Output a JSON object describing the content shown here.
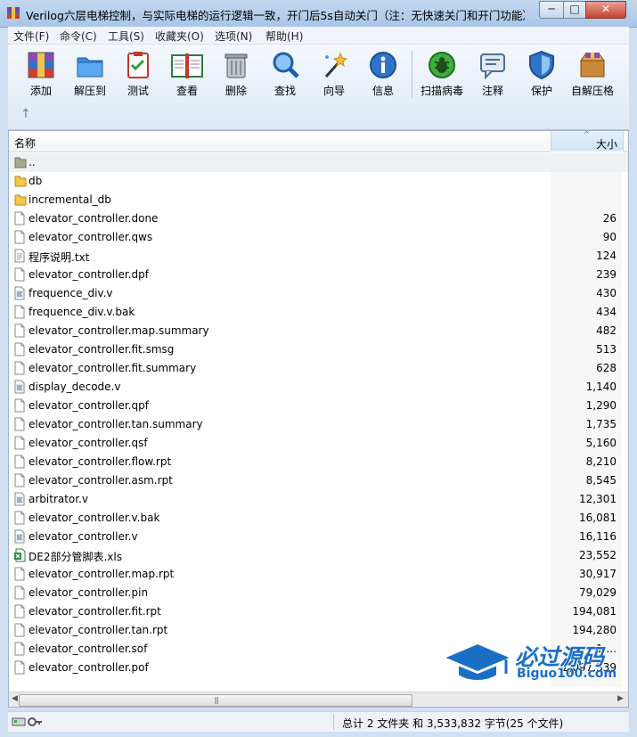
{
  "window": {
    "title": "Verilog六层电梯控制，与实际电梯的运行逻辑一致，开门后5s自动关门（注：无快速关门和开门功能）.r...",
    "minimize": "─",
    "maximize": "□",
    "close": "✕"
  },
  "menu": [
    {
      "label": "文件(F)"
    },
    {
      "label": "命令(C)"
    },
    {
      "label": "工具(S)"
    },
    {
      "label": "收藏夹(O)"
    },
    {
      "label": "选项(N)"
    },
    {
      "label": "帮助(H)"
    }
  ],
  "toolbar": {
    "add": "添加",
    "extract": "解压到",
    "test": "测试",
    "view": "查看",
    "delete": "删除",
    "find": "查找",
    "wizard": "向导",
    "info": "信息",
    "virus": "扫描病毒",
    "comment": "注释",
    "protect": "保护",
    "sfx": "自解压格"
  },
  "columns": {
    "name": "名称",
    "size": "大小",
    "sort_indicator": "^"
  },
  "files": [
    {
      "name": "..",
      "size": "",
      "icon": "folder-up"
    },
    {
      "name": "db",
      "size": "",
      "icon": "folder"
    },
    {
      "name": "incremental_db",
      "size": "",
      "icon": "folder"
    },
    {
      "name": "elevator_controller.done",
      "size": "26",
      "icon": "file"
    },
    {
      "name": "elevator_controller.qws",
      "size": "90",
      "icon": "file"
    },
    {
      "name": "程序说明.txt",
      "size": "124",
      "icon": "text-file"
    },
    {
      "name": "elevator_controller.dpf",
      "size": "239",
      "icon": "file"
    },
    {
      "name": "frequence_div.v",
      "size": "430",
      "icon": "code-file"
    },
    {
      "name": "frequence_div.v.bak",
      "size": "434",
      "icon": "file"
    },
    {
      "name": "elevator_controller.map.summary",
      "size": "482",
      "icon": "file"
    },
    {
      "name": "elevator_controller.fit.smsg",
      "size": "513",
      "icon": "file"
    },
    {
      "name": "elevator_controller.fit.summary",
      "size": "628",
      "icon": "file"
    },
    {
      "name": "display_decode.v",
      "size": "1,140",
      "icon": "code-file"
    },
    {
      "name": "elevator_controller.qpf",
      "size": "1,290",
      "icon": "file"
    },
    {
      "name": "elevator_controller.tan.summary",
      "size": "1,735",
      "icon": "file"
    },
    {
      "name": "elevator_controller.qsf",
      "size": "5,160",
      "icon": "file"
    },
    {
      "name": "elevator_controller.flow.rpt",
      "size": "8,210",
      "icon": "file"
    },
    {
      "name": "elevator_controller.asm.rpt",
      "size": "8,545",
      "icon": "file"
    },
    {
      "name": "arbitrator.v",
      "size": "12,301",
      "icon": "code-file"
    },
    {
      "name": "elevator_controller.v.bak",
      "size": "16,081",
      "icon": "file"
    },
    {
      "name": "elevator_controller.v",
      "size": "16,116",
      "icon": "code-file"
    },
    {
      "name": "DE2部分管脚表.xls",
      "size": "23,552",
      "icon": "excel-file"
    },
    {
      "name": "elevator_controller.map.rpt",
      "size": "30,917",
      "icon": "file"
    },
    {
      "name": "elevator_controller.pin",
      "size": "79,029",
      "icon": "file"
    },
    {
      "name": "elevator_controller.fit.rpt",
      "size": "194,081",
      "icon": "file"
    },
    {
      "name": "elevator_controller.tan.rpt",
      "size": "194,280",
      "icon": "file"
    },
    {
      "name": "elevator_controller.sof",
      "size": "1,...",
      "icon": "file"
    },
    {
      "name": "elevator_controller.pof",
      "size": "2,097,339",
      "icon": "file"
    }
  ],
  "status": {
    "summary": "总计 2 文件夹 和 3,533,832 字节(25 个文件)"
  },
  "watermark": {
    "title": "必过源码",
    "subtitle": "Biguo100.com"
  },
  "colors": {
    "title_bar": "#b4cde9",
    "toolbar": "#e9f0f8",
    "watermark_blue": "#1a6fc4",
    "close_red": "#c5422d"
  }
}
